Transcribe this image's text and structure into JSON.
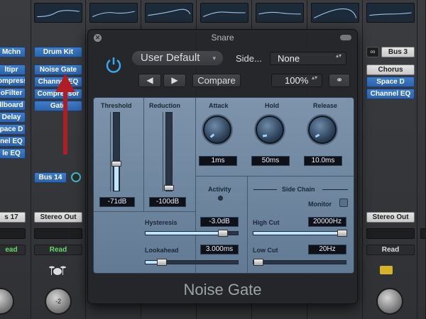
{
  "mixer": {
    "left_strip": {
      "slots": [
        "Mchn",
        "ltipr",
        "ompressor",
        "oFilter",
        "llboard",
        "Delay",
        "pace D",
        "nel EQ",
        "le EQ"
      ],
      "bus": "s 17",
      "read": "ead"
    },
    "drum_strip": {
      "name": "Drum Kit",
      "slots": [
        "Noise Gate",
        "Channel EQ",
        "Compressor",
        "Gate"
      ],
      "bus": "Bus 14",
      "output": "Stereo Out",
      "read": "Read",
      "pan": "-2"
    },
    "bus3_strip": {
      "name": "Bus 3",
      "slots": [
        "Chorus",
        "Space D",
        "Channel EQ"
      ],
      "output": "Stereo Out",
      "read": "Read"
    }
  },
  "plugin": {
    "title": "Snare",
    "close_glyph": "✕",
    "preset": "User Default",
    "preset_dropdown_glyph": "▾",
    "side_label": "Side...",
    "side_value": "None",
    "updown_glyph": "▴▾",
    "prev_glyph": "◀",
    "next_glyph": "▶",
    "compare_label": "Compare",
    "zoom": "100%",
    "link_glyph": "⚭",
    "name": "Noise Gate",
    "threshold": {
      "label": "Threshold",
      "value": "-71dB"
    },
    "reduction": {
      "label": "Reduction",
      "value": "-100dB"
    },
    "attack": {
      "label": "Attack",
      "value": "1ms"
    },
    "hold": {
      "label": "Hold",
      "value": "50ms"
    },
    "release": {
      "label": "Release",
      "value": "10.0ms"
    },
    "activity": {
      "label": "Activity"
    },
    "hysteresis": {
      "label": "Hysteresis",
      "value": "-3.0dB"
    },
    "lookahead": {
      "label": "Lookahead",
      "value": "3.000ms"
    },
    "sidechain": {
      "label": "Side Chain",
      "monitor_label": "Monitor",
      "high_cut_label": "High Cut",
      "high_cut_value": "20000Hz",
      "low_cut_label": "Low Cut",
      "low_cut_value": "20Hz"
    }
  },
  "colors": {
    "accent_blue": "#3f7cc9",
    "panel": "#7e94ac",
    "arrow": "#b01e25",
    "read_green": "#6bd46b"
  }
}
